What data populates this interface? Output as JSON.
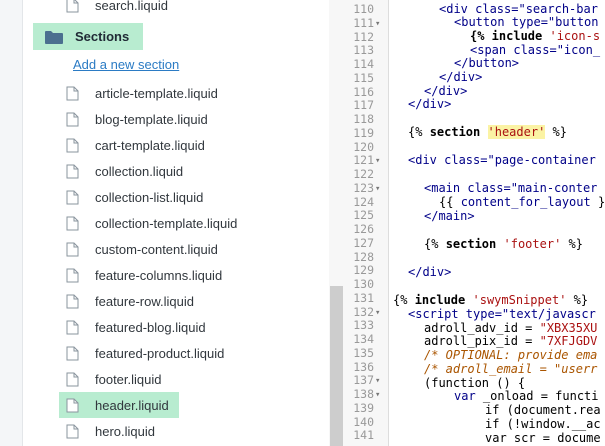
{
  "sidebar": {
    "top_partial_item": "search.liquid",
    "section_title": "Sections",
    "add_link": "Add a new section",
    "files": [
      "article-template.liquid",
      "blog-template.liquid",
      "cart-template.liquid",
      "collection.liquid",
      "collection-list.liquid",
      "collection-template.liquid",
      "custom-content.liquid",
      "feature-columns.liquid",
      "feature-row.liquid",
      "featured-blog.liquid",
      "featured-product.liquid",
      "footer.liquid",
      "header.liquid",
      "hero.liquid"
    ],
    "selected_file": "header.liquid"
  },
  "editor": {
    "line_numbers": [
      "110",
      "111",
      "112",
      "113",
      "114",
      "115",
      "116",
      "117",
      "118",
      "119",
      "120",
      "121",
      "122",
      "123",
      "124",
      "125",
      "126",
      "127",
      "128",
      "129",
      "130",
      "131",
      "132",
      "133",
      "134",
      "135",
      "136",
      "137",
      "138",
      "139",
      "140",
      "141"
    ],
    "lines": {
      "l110": "<div class=\"search-bar",
      "l111": "<button type=\"button",
      "l112_kw": "{% include",
      "l112_str": " 'icon-s",
      "l113": "<span class=\"icon_",
      "l114": "</button>",
      "l115": "</div>",
      "l116": "</div>",
      "l117": "</div>",
      "l119_a": "{% ",
      "l119_kw": "section",
      "l119_str": "'header'",
      "l119_b": " %}",
      "l121": "<div class=\"page-container",
      "l123": "<main class=\"main-conter",
      "l124_a": "{{ ",
      "l124_id": "content_for_layout",
      "l124_b": " }",
      "l125": "</main>",
      "l127_a": "{% ",
      "l127_kw": "section",
      "l127_str": "'footer'",
      "l127_b": " %}",
      "l129": "</div>",
      "l131_a": "{% ",
      "l131_kw": "include",
      "l131_str": "'swymSnippet'",
      "l131_b": " %}",
      "l132": "<script type=\"text/javascr",
      "l133_a": "adroll_adv_id = ",
      "l133_s": "\"XBX35XU",
      "l134_a": "adroll_pix_id = ",
      "l134_s": "\"7XFJGDV",
      "l135": "/* OPTIONAL: provide ema",
      "l136": "/* adroll_email = \"userr",
      "l137": "(function () {",
      "l138_a": "var ",
      "l138_b": "_onload = functi",
      "l139": "if (document.rea",
      "l140": "if (!window.__ac",
      "l141": "var scr = docume"
    }
  }
}
